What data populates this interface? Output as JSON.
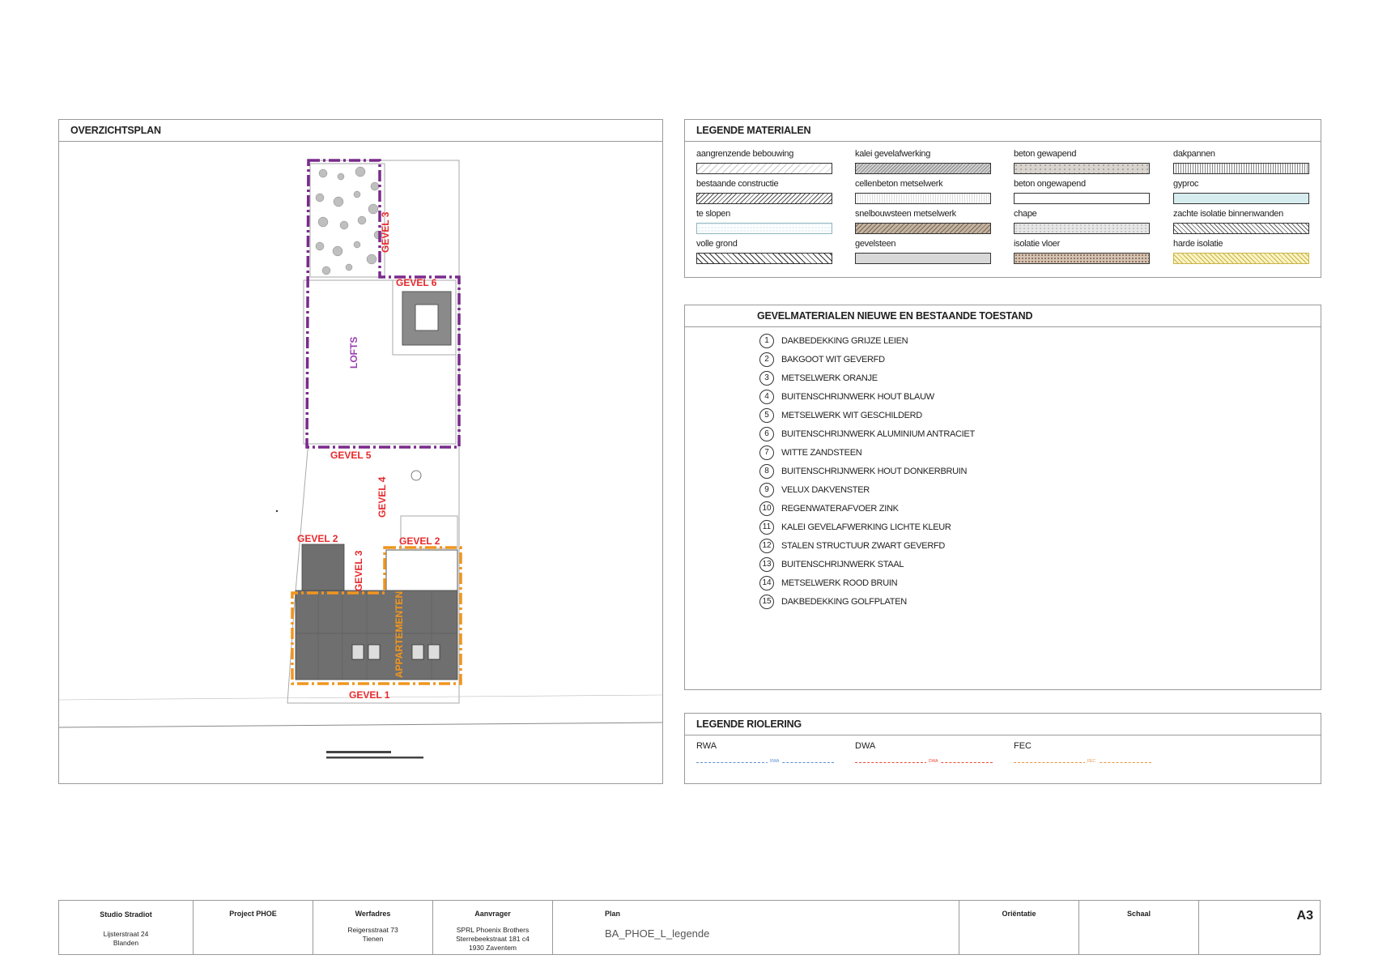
{
  "overview": {
    "title": "OVERZICHTSPLAN",
    "labels": {
      "gevel3_top": "GEVEL 3",
      "gevel6": "GEVEL 6",
      "lofts": "LOFTS",
      "gevel5": "GEVEL 5",
      "gevel4": "GEVEL 4",
      "gevel2_left": "GEVEL 2",
      "gevel2_right": "GEVEL 2",
      "gevel3_bottom": "GEVEL 3",
      "appartementen": "APPARTEMENTEN",
      "gevel1": "GEVEL 1"
    },
    "colors": {
      "lofts": "#7a2a8c",
      "apartments": "#f0951e",
      "gevel": "#e8282b",
      "roof": "#6f6f6f"
    }
  },
  "materials": {
    "title": "LEGENDE MATERIALEN",
    "items": [
      {
        "label": "aangrenzende bebouwing"
      },
      {
        "label": "kalei gevelafwerking"
      },
      {
        "label": "beton gewapend"
      },
      {
        "label": "dakpannen"
      },
      {
        "label": "bestaande constructie"
      },
      {
        "label": "cellenbeton metselwerk"
      },
      {
        "label": "beton ongewapend"
      },
      {
        "label": "gyproc"
      },
      {
        "label": "te slopen"
      },
      {
        "label": "snelbouwsteen metselwerk"
      },
      {
        "label": "chape"
      },
      {
        "label": "zachte isolatie binnenwanden"
      },
      {
        "label": "volle grond"
      },
      {
        "label": "gevelsteen"
      },
      {
        "label": "isolatie vloer"
      },
      {
        "label": "harde isolatie"
      }
    ]
  },
  "facade": {
    "title": "GEVELMATERIALEN NIEUWE EN BESTAANDE TOESTAND",
    "items": [
      {
        "num": "1",
        "text": "DAKBEDEKKING GRIJZE LEIEN"
      },
      {
        "num": "2",
        "text": "BAKGOOT WIT GEVERFD"
      },
      {
        "num": "3",
        "text": "METSELWERK ORANJE"
      },
      {
        "num": "4",
        "text": "BUITENSCHRIJNWERK HOUT BLAUW"
      },
      {
        "num": "5",
        "text": "METSELWERK WIT GESCHILDERD"
      },
      {
        "num": "6",
        "text": "BUITENSCHRIJNWERK ALUMINIUM ANTRACIET"
      },
      {
        "num": "7",
        "text": "WITTE ZANDSTEEN"
      },
      {
        "num": "8",
        "text": "BUITENSCHRIJNWERK HOUT DONKERBRUIN"
      },
      {
        "num": "9",
        "text": "VELUX DAKVENSTER"
      },
      {
        "num": "10",
        "text": "REGENWATERAFVOER ZINK"
      },
      {
        "num": "11",
        "text": "KALEI GEVELAFWERKING LICHTE KLEUR"
      },
      {
        "num": "12",
        "text": "STALEN STRUCTUUR ZWART GEVERFD"
      },
      {
        "num": "13",
        "text": "BUITENSCHRIJNWERK STAAL"
      },
      {
        "num": "14",
        "text": "METSELWERK ROOD BRUIN"
      },
      {
        "num": "15",
        "text": "DAKBEDEKKING GOLFPLATEN"
      }
    ]
  },
  "sewer": {
    "title": "LEGENDE RIOLERING",
    "items": [
      {
        "label": "RWA",
        "tag": "RWA",
        "color": "#5b8fd1"
      },
      {
        "label": "DWA",
        "tag": "DWA",
        "color": "#e84a3a"
      },
      {
        "label": "FEC",
        "tag": "FEC",
        "color": "#e8923a"
      }
    ]
  },
  "footer": {
    "studio": "Studio Stradiot",
    "studio_addr1": "Lijsterstraat 24",
    "studio_addr2": "Blanden",
    "project": "Project PHOE",
    "werfadres_head": "Werfadres",
    "werfadres1": "Reigersstraat 73",
    "werfadres2": "Tienen",
    "aanvrager_head": "Aanvrager",
    "aanvrager1": "SPRL Phoenix Brothers",
    "aanvrager2": "Sterrebeekstraat 181 c4",
    "aanvrager3": "1930 Zaventem",
    "plan_head": "Plan",
    "plan_name": "BA_PHOE_L_legende",
    "orientatie": "Oriëntatie",
    "schaal": "Schaal",
    "format": "A3"
  }
}
